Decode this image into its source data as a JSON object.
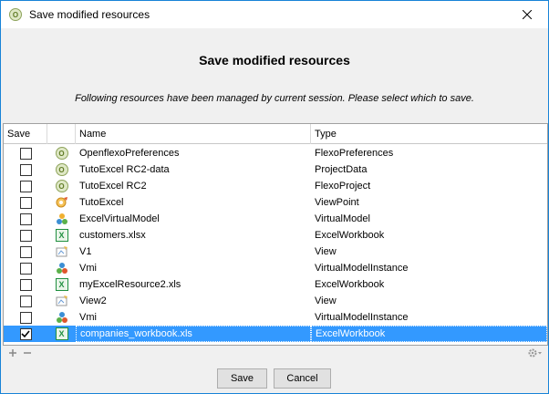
{
  "window": {
    "title": "Save modified resources"
  },
  "header": {
    "title": "Save modified resources",
    "subtitle": "Following resources have been managed by current session. Please select which to save."
  },
  "table": {
    "columns": {
      "save": "Save",
      "name": "Name",
      "type": "Type"
    },
    "rows": [
      {
        "checked": false,
        "icon": "flexo-icon",
        "name": "OpenflexoPreferences",
        "type": "FlexoPreferences",
        "selected": false
      },
      {
        "checked": false,
        "icon": "flexo-icon",
        "name": "TutoExcel RC2-data",
        "type": "ProjectData",
        "selected": false
      },
      {
        "checked": false,
        "icon": "flexo-icon",
        "name": "TutoExcel RC2",
        "type": "FlexoProject",
        "selected": false
      },
      {
        "checked": false,
        "icon": "viewpoint-icon",
        "name": "TutoExcel",
        "type": "ViewPoint",
        "selected": false
      },
      {
        "checked": false,
        "icon": "virtual-model-icon",
        "name": "ExcelVirtualModel",
        "type": "VirtualModel",
        "selected": false
      },
      {
        "checked": false,
        "icon": "excel-icon",
        "name": "customers.xlsx",
        "type": "ExcelWorkbook",
        "selected": false
      },
      {
        "checked": false,
        "icon": "view-icon",
        "name": "V1",
        "type": "View",
        "selected": false
      },
      {
        "checked": false,
        "icon": "virtual-model-instance-icon",
        "name": "Vmi",
        "type": "VirtualModelInstance",
        "selected": false
      },
      {
        "checked": false,
        "icon": "excel-icon",
        "name": "myExcelResource2.xls",
        "type": "ExcelWorkbook",
        "selected": false
      },
      {
        "checked": false,
        "icon": "view-icon",
        "name": "View2",
        "type": "View",
        "selected": false
      },
      {
        "checked": false,
        "icon": "virtual-model-instance-icon",
        "name": "Vmi",
        "type": "VirtualModelInstance",
        "selected": false
      },
      {
        "checked": true,
        "icon": "excel-icon",
        "name": "companies_workbook.xls",
        "type": "ExcelWorkbook",
        "selected": true
      }
    ]
  },
  "buttons": {
    "save": "Save",
    "cancel": "Cancel"
  },
  "colors": {
    "selection": "#3399ff",
    "border": "#1883d7",
    "excel": "#1f8f3f"
  }
}
